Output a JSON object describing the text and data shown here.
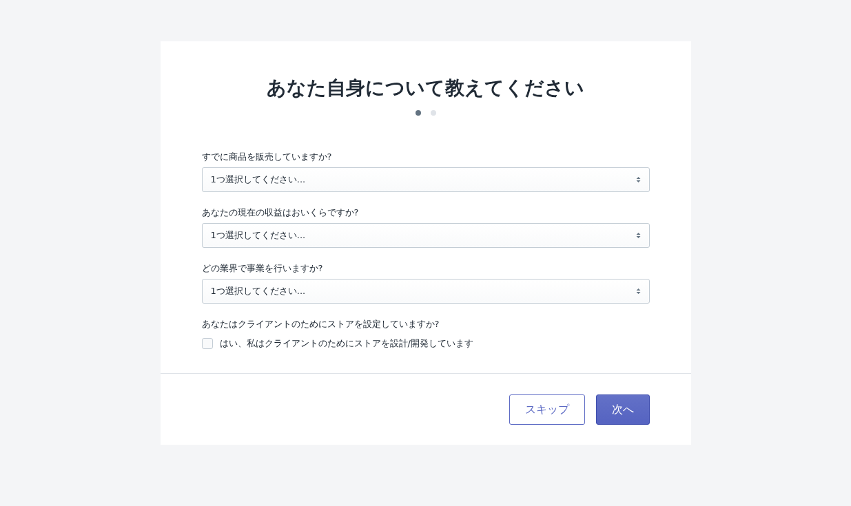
{
  "title": "あなた自身について教えてください",
  "steps": [
    {
      "selected": true
    },
    {
      "selected": false
    }
  ],
  "questions": [
    {
      "label": "すでに商品を販売していますか?",
      "placeholder": "1つ選択してください..."
    },
    {
      "label": "あなたの現在の収益はおいくらですか?",
      "placeholder": "1つ選択してください..."
    },
    {
      "label": "どの業界で事業を行いますか?",
      "placeholder": "1つ選択してください..."
    }
  ],
  "client_question": {
    "label": "あなたはクライアントのためにストアを設定していますか?",
    "checkbox": {
      "label": "はい、私はクライアントのためにストアを設計/開発しています",
      "checked": false
    }
  },
  "buttons": [
    {
      "label": "スキップ",
      "kind": "secondary"
    },
    {
      "label": "次へ",
      "kind": "primary"
    }
  ]
}
